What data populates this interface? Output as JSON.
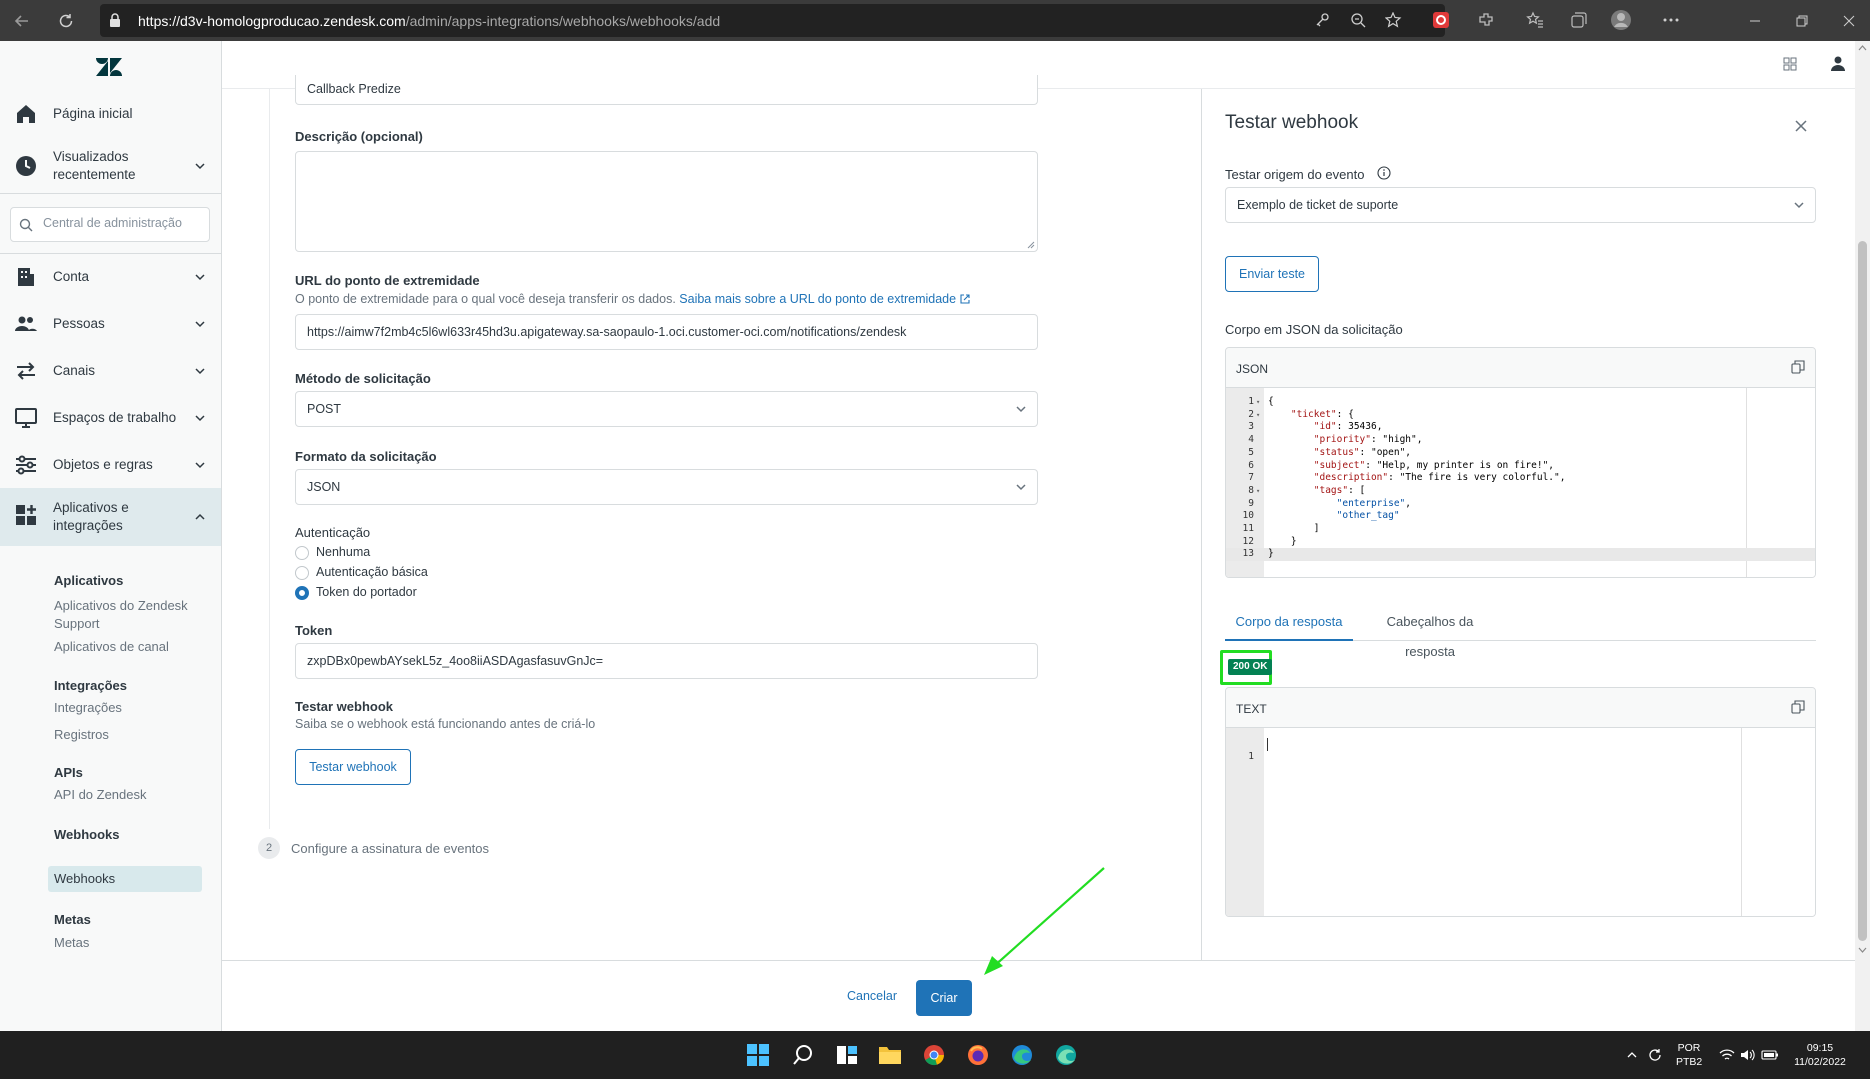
{
  "browser": {
    "url_host": "https://d3v-homologproducao.zendesk.com",
    "url_path": "/admin/apps-integrations/webhooks/webhooks/add"
  },
  "sidebar": {
    "search_placeholder": "Central de administração",
    "items": [
      {
        "label": "Página inicial",
        "icon": "home-icon"
      },
      {
        "label": "Visualizados recentemente",
        "icon": "clock-icon"
      },
      {
        "label": "Conta",
        "icon": "building-icon"
      },
      {
        "label": "Pessoas",
        "icon": "people-icon"
      },
      {
        "label": "Canais",
        "icon": "arrows-icon"
      },
      {
        "label": "Espaços de trabalho",
        "icon": "monitor-icon"
      },
      {
        "label": "Objetos e regras",
        "icon": "rules-icon"
      },
      {
        "label": "Aplicativos e integrações",
        "icon": "apps-icon"
      }
    ],
    "subgroups": {
      "apps": {
        "title": "Aplicativos",
        "links": [
          "Aplicativos do Zendesk Support",
          "Aplicativos de canal"
        ]
      },
      "integrations": {
        "title": "Integrações",
        "links": [
          "Integrações",
          "Registros"
        ]
      },
      "apis": {
        "title": "APIs",
        "links": [
          "API do Zendesk"
        ]
      },
      "webhooks": {
        "title": "Webhooks",
        "links": [
          "Webhooks"
        ]
      },
      "goals": {
        "title": "Metas",
        "links": [
          "Metas"
        ]
      }
    }
  },
  "form": {
    "name_value": "Callback Predize",
    "description_label": "Descrição (opcional)",
    "description_value": "",
    "endpoint_label": "URL do ponto de extremidade",
    "endpoint_hint": "O ponto de extremidade para o qual você deseja transferir os dados.",
    "endpoint_hint_link": "Saiba mais sobre a URL do ponto de extremidade",
    "endpoint_value": "https://aimw7f2mb4c5l6wl633r45hd3u.apigateway.sa-saopaulo-1.oci.customer-oci.com/notifications/zendesk",
    "method_label": "Método de solicitação",
    "method_value": "POST",
    "format_label": "Formato da solicitação",
    "format_value": "JSON",
    "auth_label": "Autenticação",
    "auth_options": [
      "Nenhuma",
      "Autenticação básica",
      "Token do portador"
    ],
    "auth_selected": "Token do portador",
    "token_label": "Token",
    "token_value": "zxpDBx0pewbAYsekL5z_4oo8iiASDAgasfasuvGnJc=",
    "test_title": "Testar webhook",
    "test_hint": "Saiba se o webhook está funcionando antes de criá-lo",
    "test_button": "Testar webhook",
    "step2_number": "2",
    "step2_label": "Configure a assinatura de eventos"
  },
  "footer": {
    "cancel_label": "Cancelar",
    "create_label": "Criar"
  },
  "panel": {
    "title": "Testar webhook",
    "origin_label": "Testar origem do evento",
    "origin_value": "Exemplo de ticket de suporte",
    "send_button": "Enviar teste",
    "body_label": "Corpo em JSON da solicitação",
    "json_header": "JSON",
    "json_lines": [
      "{",
      "    \"ticket\": {",
      "        \"id\": 35436,",
      "        \"priority\": \"high\",",
      "        \"status\": \"open\",",
      "        \"subject\": \"Help, my printer is on fire!\",",
      "        \"description\": \"The fire is very colorful.\",",
      "        \"tags\": [",
      "            \"enterprise\",",
      "            \"other_tag\"",
      "        ]",
      "    }",
      "}"
    ],
    "tabs": [
      "Corpo da resposta",
      "Cabeçalhos da resposta"
    ],
    "active_tab": "Corpo da resposta",
    "status": "200 OK",
    "status_color": "#038153",
    "text_header": "TEXT",
    "text_lines": [
      "1"
    ]
  },
  "taskbar": {
    "lang_top": "POR",
    "lang_bottom": "PTB2",
    "time": "09:15",
    "date": "11/02/2022"
  },
  "colors": {
    "accent": "#1f73b7",
    "highlight": "#22dd22",
    "success": "#038153"
  }
}
